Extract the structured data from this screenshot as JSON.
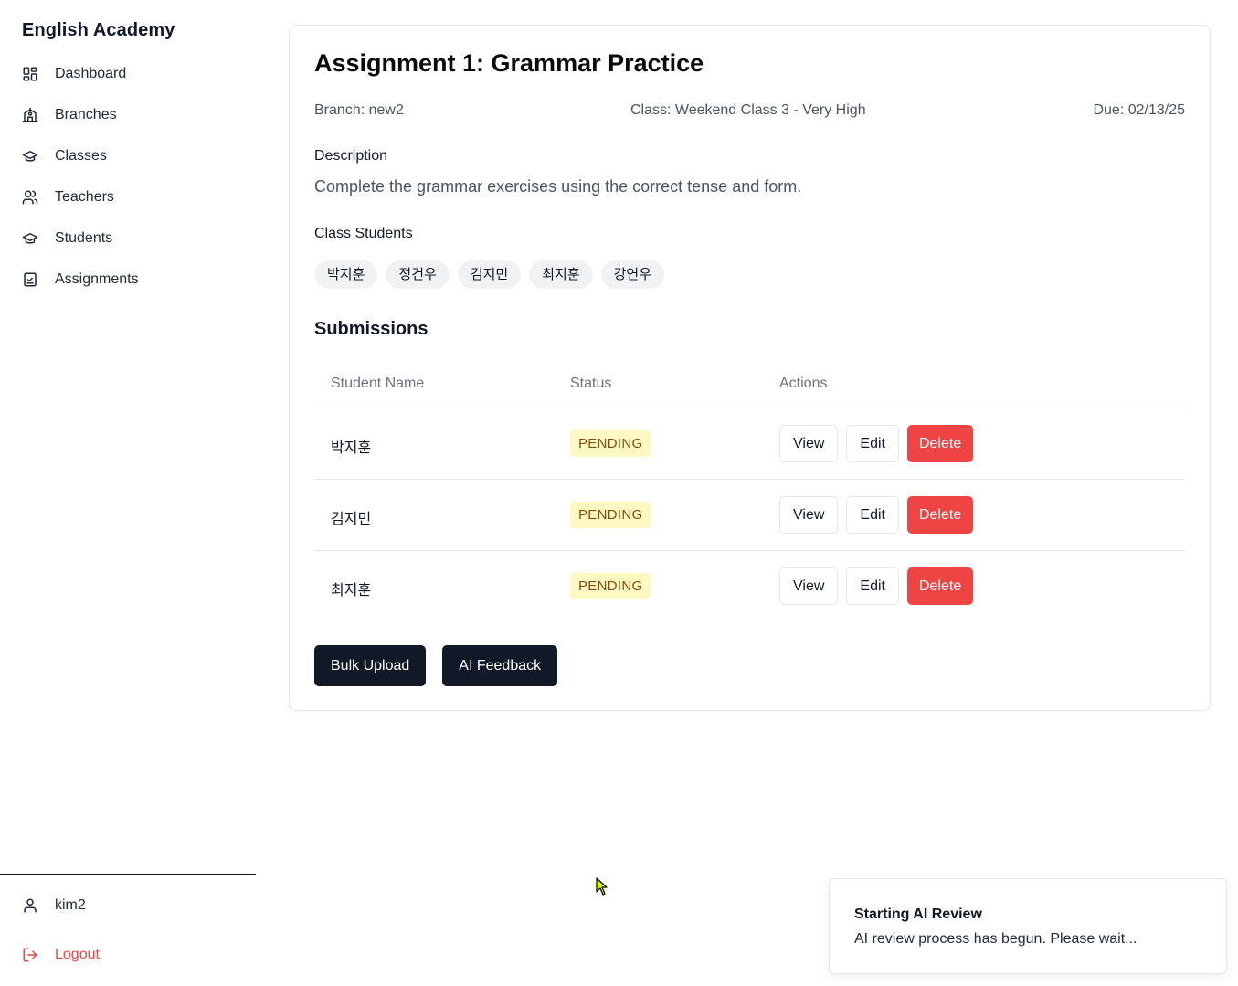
{
  "sidebar": {
    "brand": "English Academy",
    "items": [
      {
        "label": "Dashboard",
        "icon": "dashboard-icon"
      },
      {
        "label": "Branches",
        "icon": "building-icon"
      },
      {
        "label": "Classes",
        "icon": "graduation-cap-icon"
      },
      {
        "label": "Teachers",
        "icon": "users-icon"
      },
      {
        "label": "Students",
        "icon": "graduation-cap-icon"
      },
      {
        "label": "Assignments",
        "icon": "clipboard-check-icon"
      }
    ],
    "user": "kim2",
    "logout": "Logout"
  },
  "assignment": {
    "title": "Assignment 1: Grammar Practice",
    "branch": "Branch: new2",
    "class": "Class: Weekend Class 3 - Very High",
    "due": "Due: 02/13/25",
    "description_label": "Description",
    "description": "Complete the grammar exercises using the correct tense and form.",
    "students_label": "Class Students",
    "students": [
      "박지훈",
      "정건우",
      "김지민",
      "최지훈",
      "강연우"
    ]
  },
  "submissions": {
    "title": "Submissions",
    "headers": {
      "name": "Student Name",
      "status": "Status",
      "actions": "Actions"
    },
    "rows": [
      {
        "name": "박지훈",
        "status": "PENDING"
      },
      {
        "name": "김지민",
        "status": "PENDING"
      },
      {
        "name": "최지훈",
        "status": "PENDING"
      }
    ],
    "view_label": "View",
    "edit_label": "Edit",
    "delete_label": "Delete"
  },
  "buttons": {
    "bulk_upload": "Bulk Upload",
    "ai_feedback": "AI Feedback"
  },
  "toast": {
    "title": "Starting AI Review",
    "message": "AI review process has begun. Please wait..."
  },
  "colors": {
    "danger": "#ef4444",
    "dark": "#111827",
    "badge_bg": "#fef9c3",
    "badge_text": "#854d0e"
  }
}
